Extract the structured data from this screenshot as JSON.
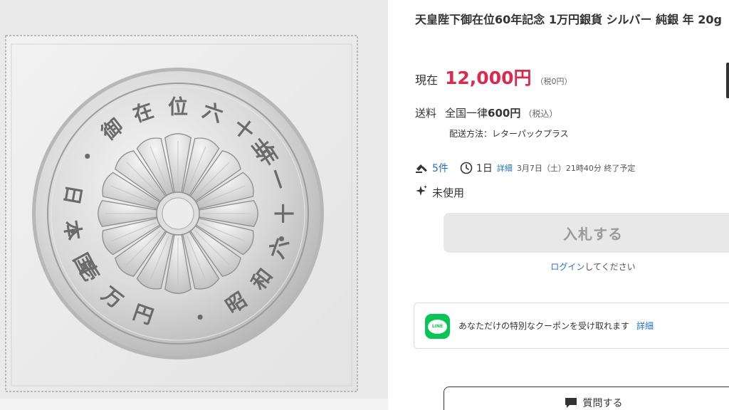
{
  "product": {
    "title": "天皇陛下御在位60年記念 1万円銀貨 シルバー 純銀 年 20g"
  },
  "price": {
    "label": "現在",
    "value": "12,000円",
    "tax": "（税0円）"
  },
  "shipping": {
    "label": "送料",
    "area": "全国一律",
    "fee": "600円",
    "tax": "（税込）",
    "method": "配送方法：レターパックプラス"
  },
  "auction": {
    "bids": "5件",
    "remaining": "1日",
    "detail_label": "詳細",
    "end_time": "3月7日（土）21時40分 終了予定",
    "bid_icon": "gavel-icon",
    "time_icon": "clock-icon"
  },
  "condition": {
    "label": "未使用",
    "icon": "sparkle-icon"
  },
  "actions": {
    "bid_label": "入札する",
    "login_link": "ログイン",
    "login_suffix": "してください",
    "question_label": "質問する",
    "question_icon": "chat-bubble-icon"
  },
  "line_promo": {
    "logo_text": "LINE",
    "text": "あなただけの特別なクーポンを受け取れます",
    "detail_label": "詳細"
  },
  "coin": {
    "top_inscription": "御在位六十年",
    "left_inscription": "日本国",
    "bottom_inscription": "昭和六十一年",
    "denomination": "壱万円",
    "dot_separator": "・"
  },
  "colors": {
    "price": "#e0284f",
    "link": "#1e6fd9",
    "line_green": "#06c755",
    "button_disabled_bg": "#e8e8e8",
    "button_disabled_text": "#9a9a9a"
  }
}
